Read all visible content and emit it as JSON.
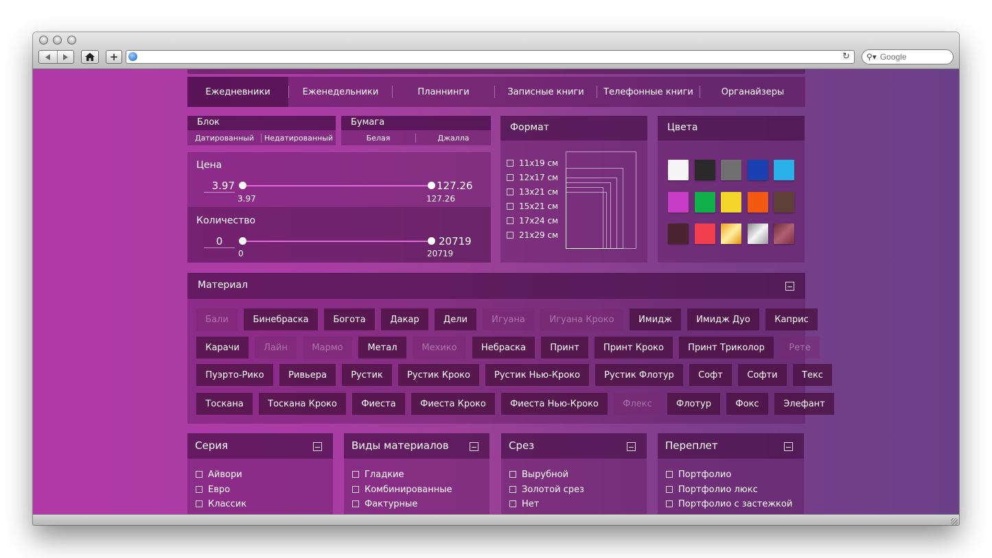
{
  "browser": {
    "search_placeholder": "Google"
  },
  "nav_tabs": [
    {
      "label": "Ежедневники"
    },
    {
      "label": "Еженедельники"
    },
    {
      "label": "Планнинги"
    },
    {
      "label": "Записные книги"
    },
    {
      "label": "Телефонные книги"
    },
    {
      "label": "Органайзеры"
    }
  ],
  "blok": {
    "title": "Блок",
    "options": [
      "Датированный",
      "Недатированный"
    ]
  },
  "bumaga": {
    "title": "Бумага",
    "options": [
      "Белая",
      "Джалла"
    ]
  },
  "price": {
    "title": "Цена",
    "min_input": "3.97",
    "max_input": "127.26",
    "min_label": "3.97",
    "max_label": "127.26",
    "range_min": 3.97,
    "range_max": 127.26
  },
  "quantity": {
    "title": "Количество",
    "min_input": "0",
    "max_input": "20719",
    "min_label": "0",
    "max_label": "20719",
    "range_min": 0,
    "range_max": 20719
  },
  "format": {
    "title": "Формат",
    "options": [
      "11х19 см",
      "12х17 см",
      "13х21 см",
      "15х21 см",
      "17х24 см",
      "21х29 см"
    ]
  },
  "colors": {
    "title": "Цвета",
    "swatches": [
      "#f5f5f5",
      "#2a2a2a",
      "#6f6f6f",
      "#1a3fb0",
      "#2ab0e8",
      "#c93ec6",
      "#12b04a",
      "#f2d42a",
      "#f25a12",
      "#5e4038",
      "#4a2430",
      "#f04050",
      "#f2b22a",
      "#b8b8b8",
      "#8a4058"
    ]
  },
  "material": {
    "title": "Материал",
    "rows": [
      [
        {
          "label": "Бали",
          "enabled": false
        },
        {
          "label": "Бинебраска",
          "enabled": true
        },
        {
          "label": "Богота",
          "enabled": true
        },
        {
          "label": "Дакар",
          "enabled": true
        },
        {
          "label": "Дели",
          "enabled": true
        },
        {
          "label": "Игуана",
          "enabled": false
        },
        {
          "label": "Игуана Кроко",
          "enabled": false
        },
        {
          "label": "Имидж",
          "enabled": true
        },
        {
          "label": "Имидж Дуо",
          "enabled": true
        },
        {
          "label": "Каприс",
          "enabled": true
        }
      ],
      [
        {
          "label": "Карачи",
          "enabled": true
        },
        {
          "label": "Лайн",
          "enabled": false
        },
        {
          "label": "Мармо",
          "enabled": false
        },
        {
          "label": "Метал",
          "enabled": true
        },
        {
          "label": "Мехико",
          "enabled": false
        },
        {
          "label": "Небраска",
          "enabled": true
        },
        {
          "label": "Принт",
          "enabled": true
        },
        {
          "label": "Принт Кроко",
          "enabled": true
        },
        {
          "label": "Принт Триколор",
          "enabled": true
        },
        {
          "label": "Рете",
          "enabled": false
        }
      ],
      [
        {
          "label": "Пуэрто-Рико",
          "enabled": true
        },
        {
          "label": "Ривьера",
          "enabled": true
        },
        {
          "label": "Рустик",
          "enabled": true
        },
        {
          "label": "Рустик Кроко",
          "enabled": true
        },
        {
          "label": "Рустик Нью-Кроко",
          "enabled": true
        },
        {
          "label": "Рустик Флотур",
          "enabled": true
        },
        {
          "label": "Софт",
          "enabled": true
        },
        {
          "label": "Софти",
          "enabled": true
        },
        {
          "label": "Текс",
          "enabled": true
        }
      ],
      [
        {
          "label": "Тоскана",
          "enabled": true
        },
        {
          "label": "Тоскана Кроко",
          "enabled": true
        },
        {
          "label": "Фиеста",
          "enabled": true
        },
        {
          "label": "Фиеста Кроко",
          "enabled": true
        },
        {
          "label": "Фиеста Нью-Кроко",
          "enabled": true
        },
        {
          "label": "Флекс",
          "enabled": false
        },
        {
          "label": "Флотур",
          "enabled": true
        },
        {
          "label": "Фокс",
          "enabled": true
        },
        {
          "label": "Элефант",
          "enabled": true
        }
      ]
    ]
  },
  "bottom_panels": [
    {
      "title": "Серия",
      "items": [
        "Айвори",
        "Евро",
        "Классик"
      ]
    },
    {
      "title": "Виды материалов",
      "items": [
        "Гладкие",
        "Комбинированные",
        "Фактурные"
      ]
    },
    {
      "title": "Срез",
      "items": [
        "Вырубной",
        "Золотой срез",
        "Нет"
      ]
    },
    {
      "title": "Переплет",
      "items": [
        "Портфолио",
        "Портфолио люкс",
        "Портфолио с застежкой"
      ]
    }
  ]
}
